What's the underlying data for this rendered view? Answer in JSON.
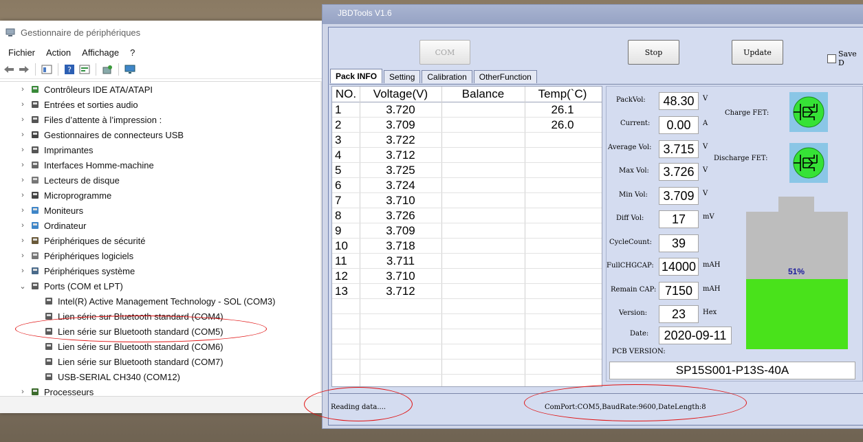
{
  "device_manager": {
    "title": "Gestionnaire de périphériques",
    "menu": [
      "Fichier",
      "Action",
      "Affichage",
      "?"
    ],
    "tree": [
      {
        "label": "Contrôleurs IDE ATA/ATAPI",
        "level": 0,
        "expanded": false,
        "icon": "ide-controller-icon"
      },
      {
        "label": "Entrées et sorties audio",
        "level": 0,
        "expanded": false,
        "icon": "speaker-icon"
      },
      {
        "label": "Files d’attente à l’impression :",
        "level": 0,
        "expanded": false,
        "icon": "printer-queue-icon"
      },
      {
        "label": "Gestionnaires de connecteurs USB",
        "level": 0,
        "expanded": false,
        "icon": "usb-icon"
      },
      {
        "label": "Imprimantes",
        "level": 0,
        "expanded": false,
        "icon": "printer-icon"
      },
      {
        "label": "Interfaces Homme-machine",
        "level": 0,
        "expanded": false,
        "icon": "hid-icon"
      },
      {
        "label": "Lecteurs de disque",
        "level": 0,
        "expanded": false,
        "icon": "disk-drive-icon"
      },
      {
        "label": "Microprogramme",
        "level": 0,
        "expanded": false,
        "icon": "firmware-icon"
      },
      {
        "label": "Moniteurs",
        "level": 0,
        "expanded": false,
        "icon": "monitor-icon"
      },
      {
        "label": "Ordinateur",
        "level": 0,
        "expanded": false,
        "icon": "computer-icon"
      },
      {
        "label": "Périphériques de sécurité",
        "level": 0,
        "expanded": false,
        "icon": "security-device-icon"
      },
      {
        "label": "Périphériques logiciels",
        "level": 0,
        "expanded": false,
        "icon": "software-device-icon"
      },
      {
        "label": "Périphériques système",
        "level": 0,
        "expanded": false,
        "icon": "system-device-icon"
      },
      {
        "label": "Ports (COM et LPT)",
        "level": 0,
        "expanded": true,
        "icon": "port-icon"
      },
      {
        "label": "Intel(R) Active Management Technology - SOL (COM3)",
        "level": 1,
        "icon": "port-icon"
      },
      {
        "label": "Lien série sur Bluetooth standard (COM4)",
        "level": 1,
        "icon": "port-icon"
      },
      {
        "label": "Lien série sur Bluetooth standard (COM5)",
        "level": 1,
        "icon": "port-icon"
      },
      {
        "label": "Lien série sur Bluetooth standard (COM6)",
        "level": 1,
        "icon": "port-icon"
      },
      {
        "label": "Lien série sur Bluetooth standard (COM7)",
        "level": 1,
        "icon": "port-icon"
      },
      {
        "label": "USB-SERIAL CH340 (COM12)",
        "level": 1,
        "icon": "port-icon"
      },
      {
        "label": "Processeurs",
        "level": 0,
        "expanded": false,
        "icon": "processor-icon"
      }
    ]
  },
  "jbd": {
    "title": "JBDTools V1.6",
    "buttons": {
      "com": "COM",
      "stop": "Stop",
      "update": "Update"
    },
    "save_label": "Save D",
    "tabs": [
      "Pack INFO",
      "Setting",
      "Calibration",
      "OtherFunction"
    ],
    "table": {
      "headers": [
        "NO.",
        "Voltage(V)",
        "Balance",
        "Temp(`C)"
      ],
      "rows": [
        [
          "1",
          "3.720",
          "",
          "26.1"
        ],
        [
          "2",
          "3.709",
          "",
          "26.0"
        ],
        [
          "3",
          "3.722",
          "",
          ""
        ],
        [
          "4",
          "3.712",
          "",
          ""
        ],
        [
          "5",
          "3.725",
          "",
          ""
        ],
        [
          "6",
          "3.724",
          "",
          ""
        ],
        [
          "7",
          "3.710",
          "",
          ""
        ],
        [
          "8",
          "3.726",
          "",
          ""
        ],
        [
          "9",
          "3.709",
          "",
          ""
        ],
        [
          "10",
          "3.718",
          "",
          ""
        ],
        [
          "11",
          "3.711",
          "",
          ""
        ],
        [
          "12",
          "3.710",
          "",
          ""
        ],
        [
          "13",
          "3.712",
          "",
          ""
        ]
      ]
    },
    "fields": {
      "packvol": {
        "label": "PackVol:",
        "value": "48.30",
        "unit": "V"
      },
      "current": {
        "label": "Current:",
        "value": "0.00",
        "unit": "A"
      },
      "avgvol": {
        "label": "Average Vol:",
        "value": "3.715",
        "unit": "V"
      },
      "maxvol": {
        "label": "Max Vol:",
        "value": "3.726",
        "unit": "V"
      },
      "minvol": {
        "label": "Min Vol:",
        "value": "3.709",
        "unit": "V"
      },
      "diffvol": {
        "label": "Diff Vol:",
        "value": "17",
        "unit": "mV"
      },
      "cyclecount": {
        "label": "CycleCount:",
        "value": "39",
        "unit": ""
      },
      "fullcap": {
        "label": "FullCHGCAP:",
        "value": "14000",
        "unit": "mAH"
      },
      "remaincap": {
        "label": "Remain CAP:",
        "value": "7150",
        "unit": "mAH"
      },
      "version": {
        "label": "Version:",
        "value": "23",
        "unit": "Hex"
      },
      "date": {
        "label": "Date:",
        "value": "2020-09-11",
        "unit": ""
      }
    },
    "charge_fet_label": "Charge FET:",
    "discharge_fet_label": "Discharge FET:",
    "battery": {
      "percent_label": "51%",
      "level": 0.51,
      "fill_color": "#49e21b"
    },
    "pcb_label": "PCB VERSION:",
    "pcb_value": "SP15S001-P13S-40A",
    "status": {
      "left": "Reading data....",
      "right": "ComPort:COM5,BaudRate:9600,DateLength:8"
    }
  }
}
